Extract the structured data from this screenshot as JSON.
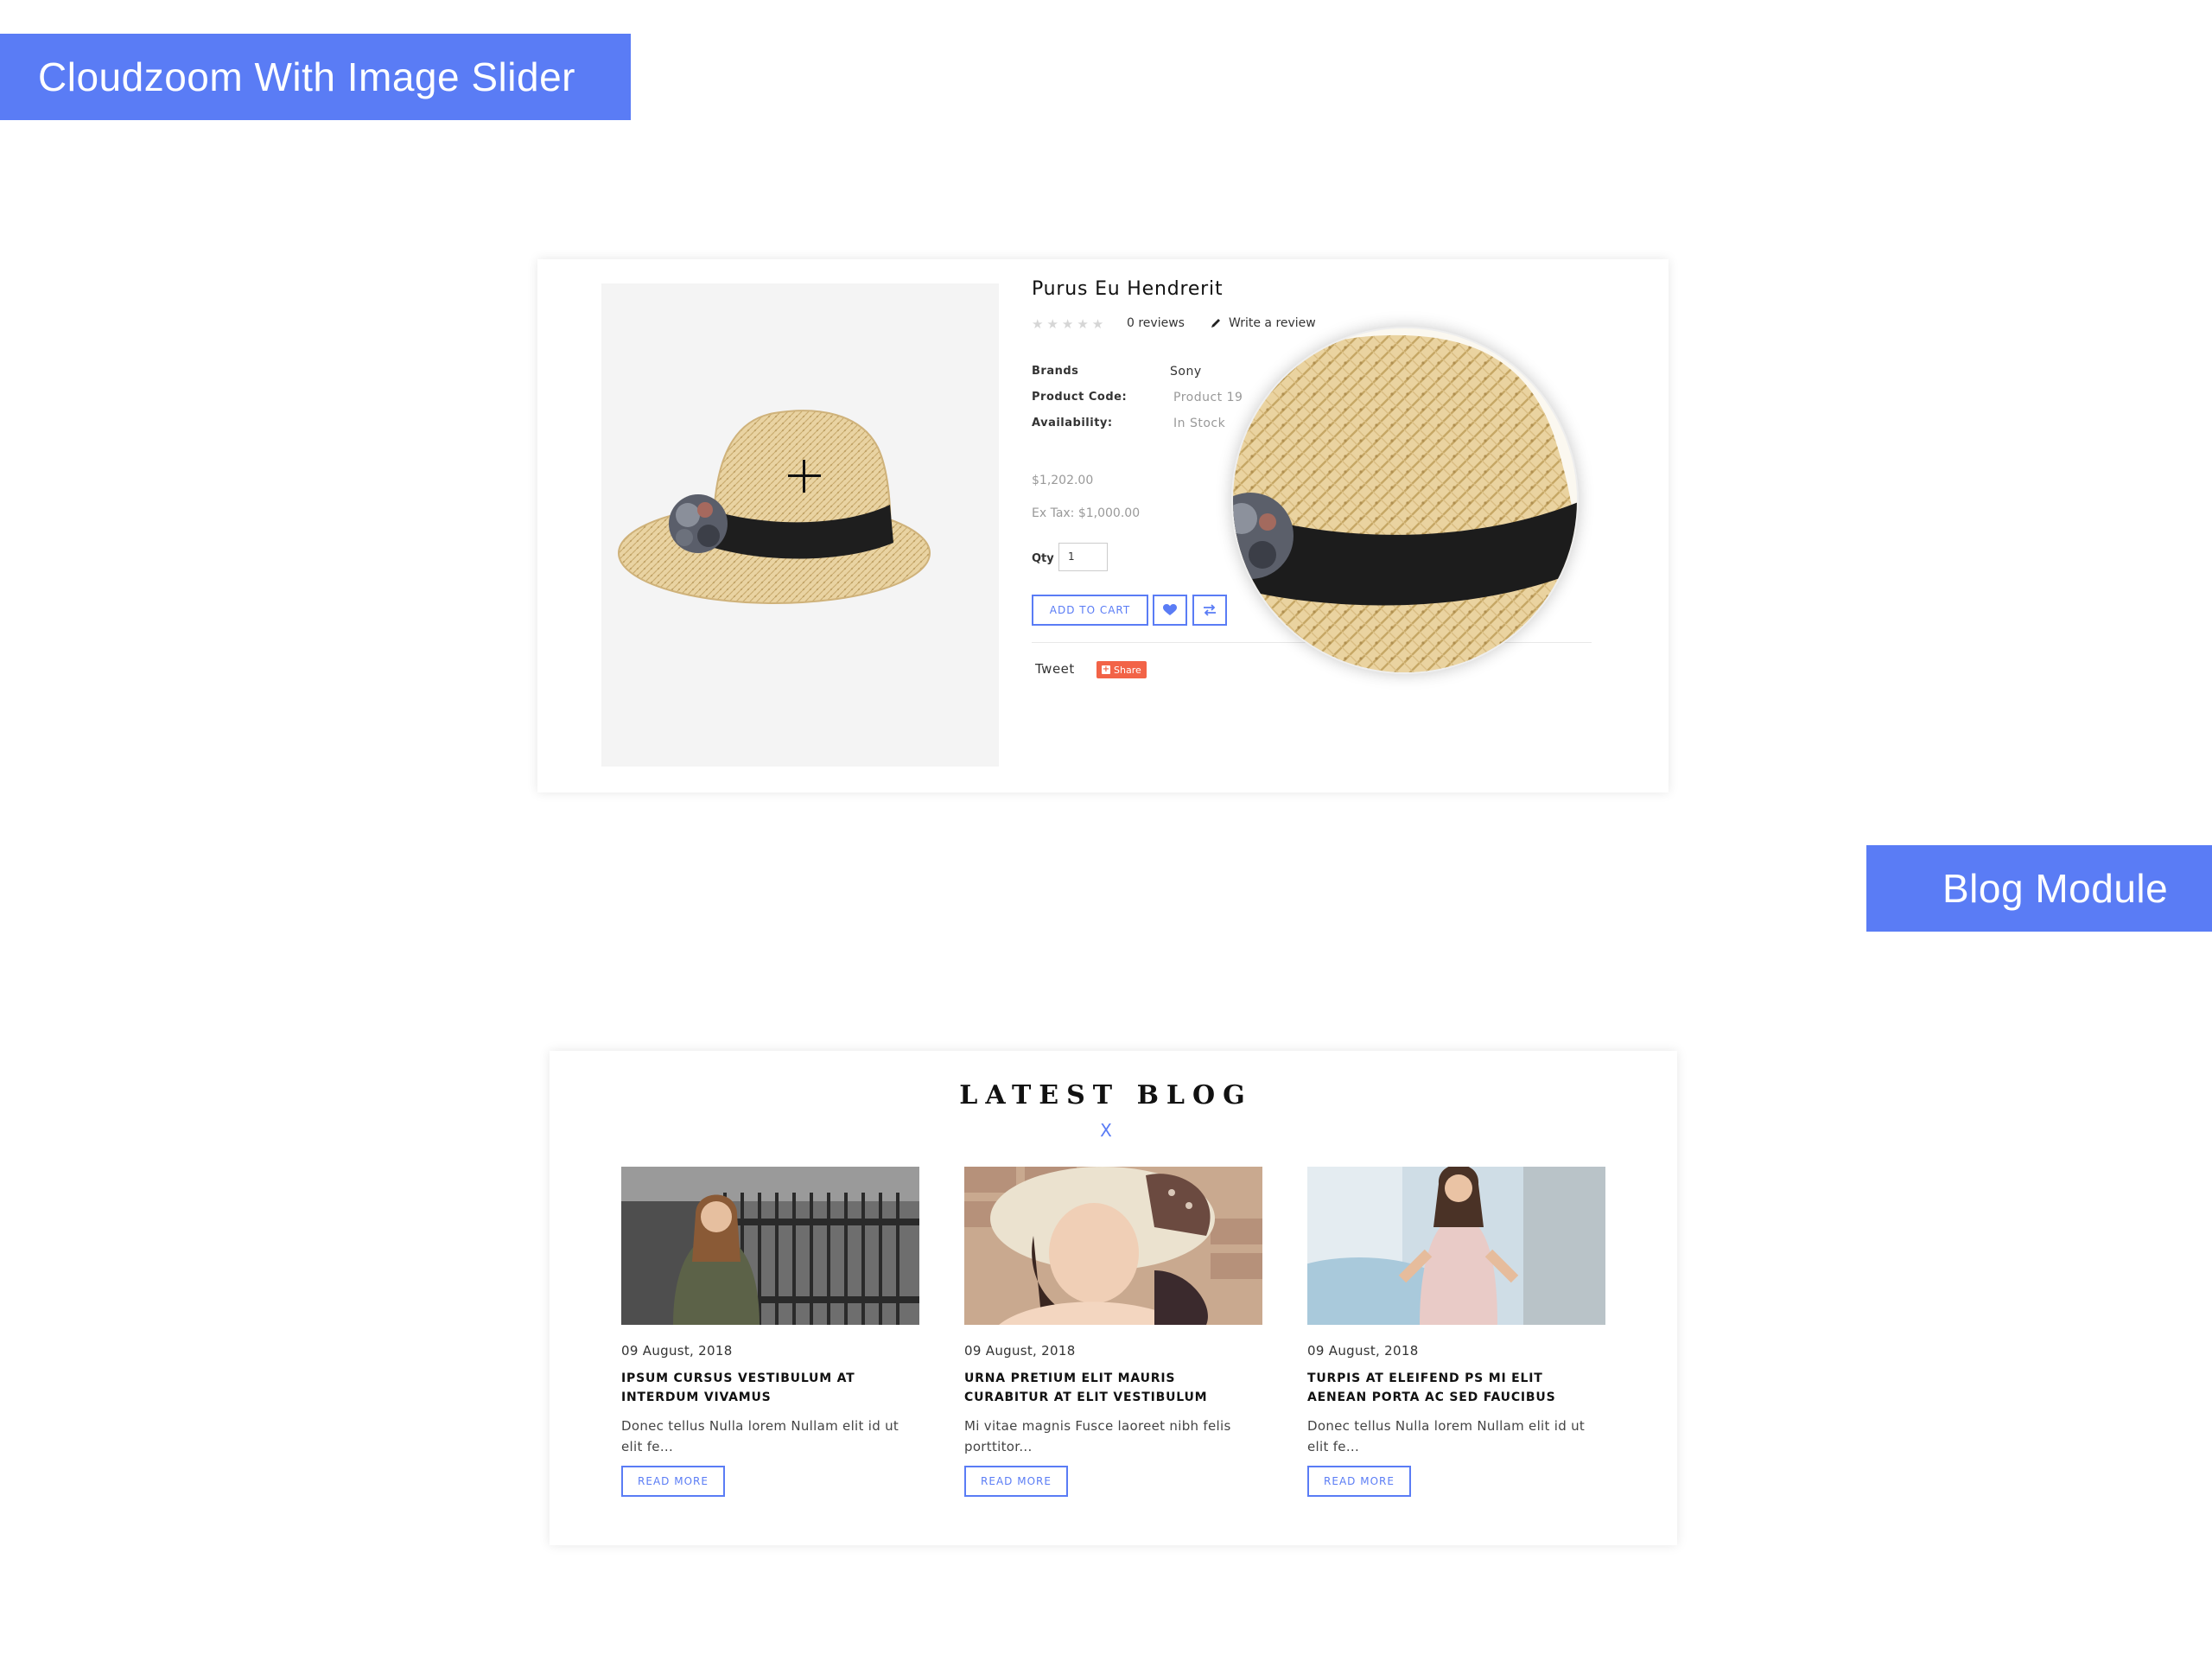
{
  "banners": {
    "left": "Cloudzoom With Image Slider",
    "right": "Blog Module"
  },
  "product": {
    "title": "Purus Eu Hendrerit",
    "stars": "★★★★★",
    "reviews": "0 reviews",
    "write_review": "Write a review",
    "specs": [
      {
        "label": "Brands",
        "value": "Sony"
      },
      {
        "label": "Product Code:",
        "value": "Product 19"
      },
      {
        "label": "Availability:",
        "value": "In Stock"
      }
    ],
    "price": "$1,202.00",
    "ex_tax": "Ex Tax: $1,000.00",
    "qty_label": "Qty",
    "qty_value": "1",
    "add_to_cart": "ADD TO CART",
    "tweet": "Tweet",
    "share": "Share"
  },
  "blog": {
    "title": "LATEST BLOG",
    "separator": "X",
    "posts": [
      {
        "date": "09 August, 2018",
        "title": "IPSUM CURSUS VESTIBULUM AT INTERDUM VIVAMUS",
        "excerpt": "Donec tellus Nulla lorem Nullam elit id ut elit fe...",
        "read_more": "READ MORE"
      },
      {
        "date": "09 August, 2018",
        "title": "URNA PRETIUM ELIT MAURIS CURABITUR AT ELIT VESTIBULUM",
        "excerpt": "Mi vitae magnis Fusce laoreet nibh felis porttitor...",
        "read_more": "READ MORE"
      },
      {
        "date": "09 August, 2018",
        "title": "TURPIS AT ELEIFEND PS MI ELIT AENEAN PORTA AC SED FAUCIBUS",
        "excerpt": "Donec tellus Nulla lorem Nullam elit id ut elit fe...",
        "read_more": "READ MORE"
      }
    ]
  },
  "colors": {
    "accent": "#5a7cf5",
    "share": "#f26347"
  }
}
